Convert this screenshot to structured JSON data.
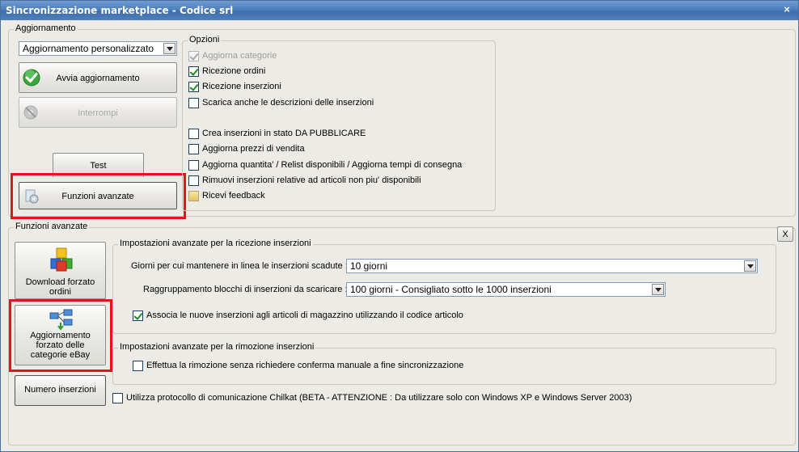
{
  "window": {
    "title": "Sincronizzazione marketplace - Codice srl",
    "close_glyph": "×"
  },
  "aggiornamento": {
    "legend": "Aggiornamento",
    "mode_select": "Aggiornamento personalizzato",
    "start_button": "Avvia aggiornamento",
    "stop_button": "Interrompi",
    "test_button": "Test",
    "advanced_button": "Funzioni avanzate"
  },
  "opzioni": {
    "legend": "Opzioni",
    "items": [
      {
        "label": "Aggiorna categorie",
        "checked": true,
        "disabled": true
      },
      {
        "label": "Ricezione ordini",
        "checked": true,
        "disabled": false
      },
      {
        "label": "Ricezione inserzioni",
        "checked": true,
        "disabled": false
      },
      {
        "label": "Scarica anche le descrizioni delle inserzioni",
        "checked": false,
        "disabled": false
      },
      {
        "label": "Crea inserzioni in stato DA PUBBLICARE",
        "checked": false,
        "disabled": false
      },
      {
        "label": "Aggiorna prezzi di vendita",
        "checked": false,
        "disabled": false
      },
      {
        "label": "Aggiorna quantita' / Relist disponibili / Aggiorna tempi di consegna",
        "checked": false,
        "disabled": false
      },
      {
        "label": "Rimuovi inserzioni relative ad articoli non piu' disponibili",
        "checked": false,
        "disabled": false
      },
      {
        "label": "Ricevi feedback",
        "checked": false,
        "disabled": false
      }
    ]
  },
  "funzioni_avanzate": {
    "legend": "Funzioni avanzate",
    "close_button": "X",
    "download_button": "Download forzato ordini",
    "categories_button": "Aggiornamento forzato delle categorie eBay",
    "count_button": "Numero inserzioni",
    "ricezione": {
      "legend": "Impostazioni avanzate per la ricezione inserzioni",
      "days_label": "Giorni per cui mantenere in linea le inserzioni scadute :",
      "days_value": "10 giorni",
      "group_label": "Raggruppamento blocchi di inserzioni da scaricare :",
      "group_value": "100 giorni - Consigliato sotto le 1000 inserzioni",
      "associate_label": "Associa le nuove inserzioni agli articoli di magazzino utilizzando il codice articolo"
    },
    "rimozione": {
      "legend": "Impostazioni avanzate per la rimozione inserzioni",
      "confirm_label": "Effettua la rimozione senza richiedere conferma manuale a fine sincronizzazione"
    },
    "chilkat_label": "Utilizza protocollo di comunicazione Chilkat (BETA - ATTENZIONE : Da utilizzare solo con Windows XP e Windows Server 2003)"
  },
  "colors": {
    "highlight": "#e3141b",
    "titlebar": "#4d7fbe"
  }
}
